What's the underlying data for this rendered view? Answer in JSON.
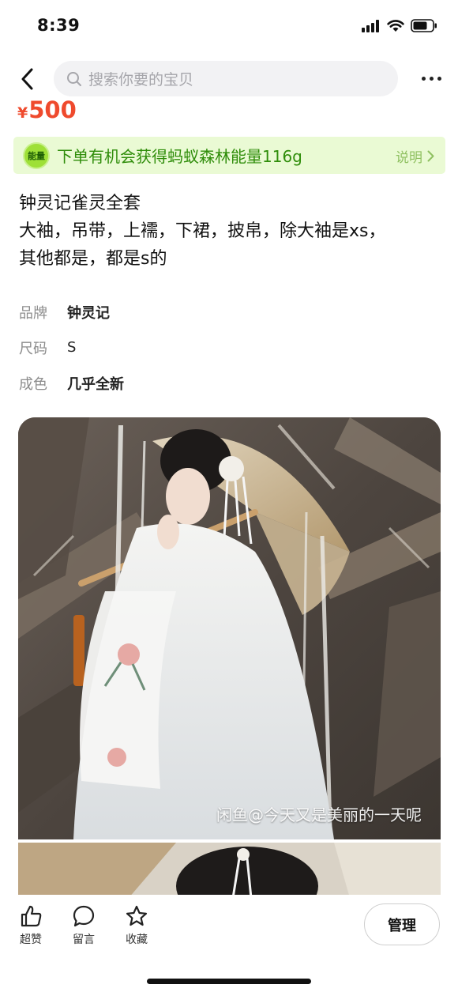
{
  "status_bar": {
    "time": "8:39"
  },
  "header": {
    "search_placeholder": "搜索你要的宝贝"
  },
  "price": {
    "currency": "¥",
    "amount": "500"
  },
  "energy_banner": {
    "badge": "能量",
    "text": "下单有机会获得蚂蚁森林能量116g",
    "explain_label": "说明"
  },
  "description": {
    "lines": [
      "钟灵记雀灵全套",
      "大袖，吊带，上襦，下裙，披帛，除大袖是xs，",
      "其他都是，都是s的"
    ]
  },
  "attributes": [
    {
      "label": "品牌",
      "value": "钟灵记"
    },
    {
      "label": "尺码",
      "value": "S"
    },
    {
      "label": "成色",
      "value": "几乎全新"
    }
  ],
  "photos": {
    "watermark": "闲鱼@今天又是美丽的一天呢"
  },
  "bottom_bar": {
    "like_label": "超赞",
    "comment_label": "留言",
    "favorite_label": "收藏",
    "manage_label": "管理"
  },
  "colors": {
    "price": "#ef4a2d",
    "energy_text": "#2f8d0a",
    "energy_bg": "#eafad4"
  }
}
